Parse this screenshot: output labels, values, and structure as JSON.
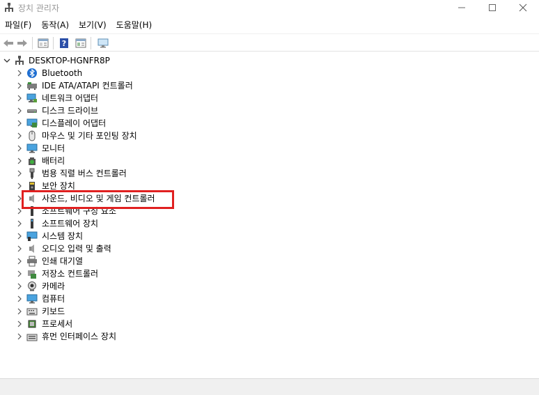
{
  "window": {
    "title": "장치 관리자"
  },
  "menu": [
    "파일(F)",
    "동작(A)",
    "보기(V)",
    "도움말(H)"
  ],
  "toolbar": {
    "icons": [
      "back-arrow-icon",
      "forward-arrow-icon",
      "properties-icon",
      "help-icon",
      "view-icon",
      "monitor-scan-icon"
    ]
  },
  "tree": {
    "root": "DESKTOP-HGNFR8P",
    "items": [
      {
        "label": "Bluetooth",
        "icon": "bluetooth-icon"
      },
      {
        "label": "IDE ATA/ATAPI 컨트롤러",
        "icon": "ide-controller-icon"
      },
      {
        "label": "네트워크 어댑터",
        "icon": "network-adapter-icon"
      },
      {
        "label": "디스크 드라이브",
        "icon": "disk-drive-icon"
      },
      {
        "label": "디스플레이 어댑터",
        "icon": "display-adapter-icon"
      },
      {
        "label": "마우스 및 기타 포인팅 장치",
        "icon": "mouse-icon"
      },
      {
        "label": "모니터",
        "icon": "monitor-icon"
      },
      {
        "label": "배터리",
        "icon": "battery-icon"
      },
      {
        "label": "범용 직렬 버스 컨트롤러",
        "icon": "usb-icon"
      },
      {
        "label": "보안 장치",
        "icon": "security-device-icon"
      },
      {
        "label": "사운드, 비디오 및 게임 컨트롤러",
        "icon": "speaker-icon",
        "highlighted": true
      },
      {
        "label": "소프트웨어 구성 요소",
        "icon": "software-component-icon"
      },
      {
        "label": "소프트웨어 장치",
        "icon": "software-device-icon"
      },
      {
        "label": "시스템 장치",
        "icon": "system-device-icon"
      },
      {
        "label": "오디오 입력 및 출력",
        "icon": "audio-io-icon"
      },
      {
        "label": "인쇄 대기열",
        "icon": "printer-icon"
      },
      {
        "label": "저장소 컨트롤러",
        "icon": "storage-controller-icon"
      },
      {
        "label": "카메라",
        "icon": "camera-icon"
      },
      {
        "label": "컴퓨터",
        "icon": "computer-icon"
      },
      {
        "label": "키보드",
        "icon": "keyboard-icon"
      },
      {
        "label": "프로세서",
        "icon": "processor-icon"
      },
      {
        "label": "휴먼 인터페이스 장치",
        "icon": "hid-icon"
      }
    ]
  },
  "colors": {
    "highlight": "#e02020",
    "title_text": "#999999"
  }
}
